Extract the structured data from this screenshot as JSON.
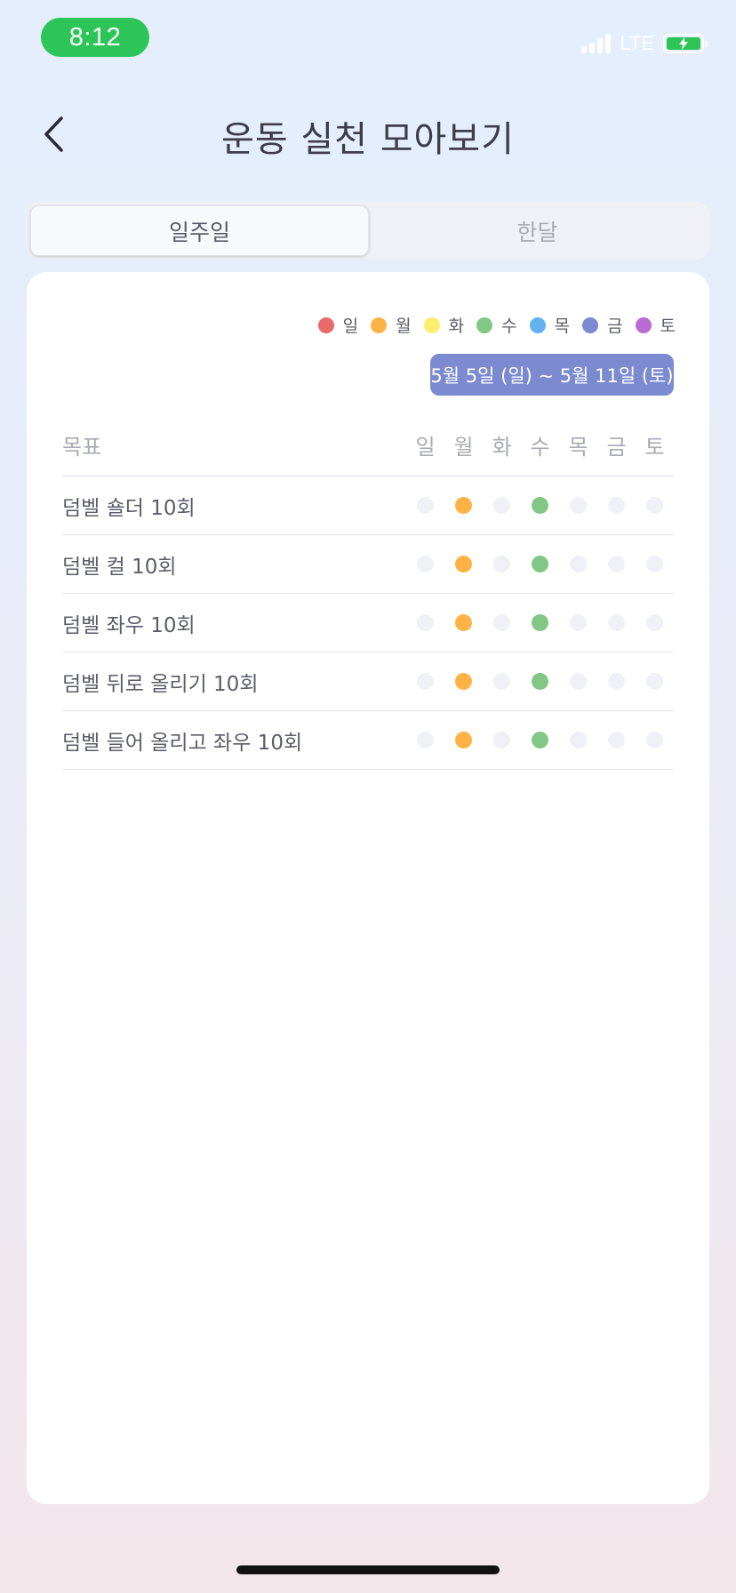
{
  "status": {
    "time": "8:12",
    "network": "LTE"
  },
  "header": {
    "title": "운동 실천 모아보기"
  },
  "segment": {
    "tabs": [
      {
        "label": "일주일",
        "active": true
      },
      {
        "label": "한달",
        "active": false
      }
    ]
  },
  "legend": [
    {
      "label": "일",
      "color": "#e86a6a"
    },
    {
      "label": "월",
      "color": "#ffb347"
    },
    {
      "label": "화",
      "color": "#fdec6f"
    },
    {
      "label": "수",
      "color": "#82c785"
    },
    {
      "label": "목",
      "color": "#62b2ef"
    },
    {
      "label": "금",
      "color": "#7c8acf"
    },
    {
      "label": "토",
      "color": "#b96bd0"
    }
  ],
  "date_range": "5월 5일 (일) ~ 5월 11일 (토)",
  "table": {
    "goal_header": "목표",
    "day_headers": [
      "일",
      "월",
      "화",
      "수",
      "목",
      "금",
      "토"
    ],
    "rows": [
      {
        "goal": "덤벨 숄더 10회",
        "done": [
          false,
          true,
          false,
          true,
          false,
          false,
          false
        ]
      },
      {
        "goal": "덤벨 컬 10회",
        "done": [
          false,
          true,
          false,
          true,
          false,
          false,
          false
        ]
      },
      {
        "goal": "덤벨 좌우 10회",
        "done": [
          false,
          true,
          false,
          true,
          false,
          false,
          false
        ]
      },
      {
        "goal": "덤벨 뒤로 올리기 10회",
        "done": [
          false,
          true,
          false,
          true,
          false,
          false,
          false
        ]
      },
      {
        "goal": "덤벨 들어 올리고 좌우 10회",
        "done": [
          false,
          true,
          false,
          true,
          false,
          false,
          false
        ]
      }
    ]
  }
}
